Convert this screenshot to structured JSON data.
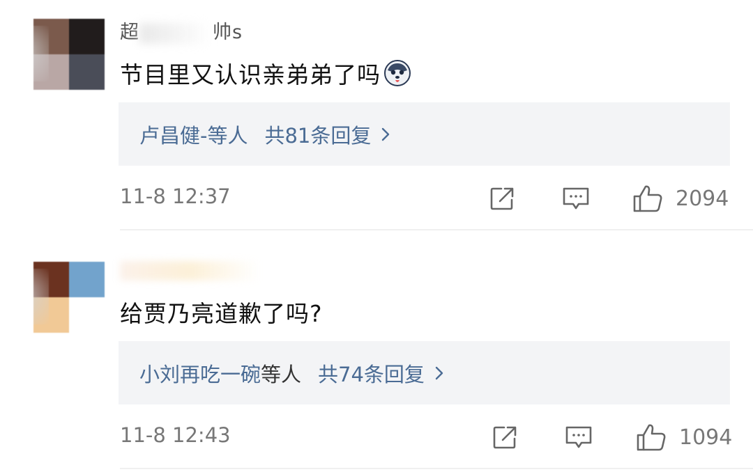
{
  "comments": [
    {
      "username_start": "超",
      "username_end": "帅s",
      "avatar_colors": [
        "#7b5a4c",
        "#211c1c",
        "#b9a7a5",
        "#4a4d58"
      ],
      "text": "节目里又认识亲弟弟了吗",
      "emoji": "husky-face-emoji",
      "reply_names": "卢昌健",
      "reply_suffix": "-等人",
      "reply_count": "共81条回复",
      "timestamp": "11-8 12:37",
      "likes": "2094"
    },
    {
      "username_start": "",
      "username_end": "",
      "avatar_colors": [
        "#6b3220",
        "#72a3cc",
        "#f1c996",
        "#ffffff"
      ],
      "text": "给贾乃亮道歉了吗?",
      "emoji": "",
      "reply_names": "小刘再吃一碗",
      "reply_suffix": "等人",
      "reply_count": "共74条回复",
      "timestamp": "11-8 12:43",
      "likes": "1094"
    }
  ],
  "icons": {
    "share": "share-icon",
    "comment": "comment-icon",
    "like": "thumbs-up-icon",
    "chevron": "chevron-right-icon"
  },
  "colors": {
    "link": "#4a6b94",
    "reply_bg": "#f3f4f6",
    "meta_text": "#777777"
  }
}
